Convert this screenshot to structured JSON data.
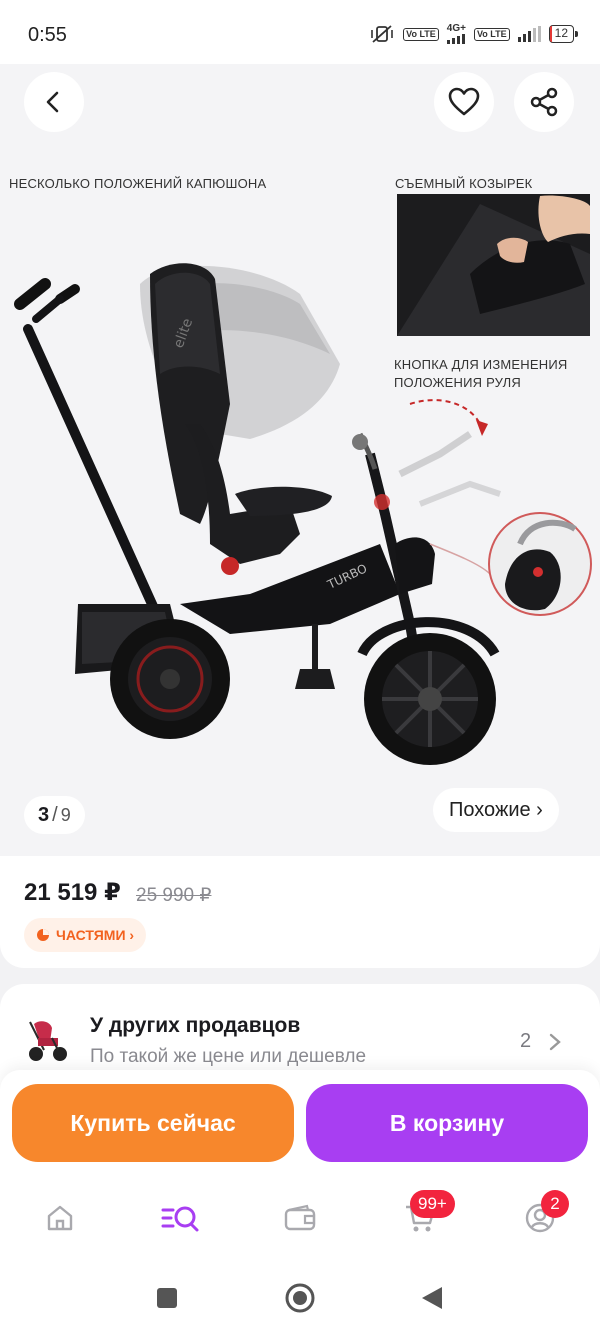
{
  "status_bar": {
    "time": "0:55",
    "volte1": "Vo LTE",
    "network": "4G+",
    "volte2": "Vo LTE",
    "battery": "12"
  },
  "gallery": {
    "captions": {
      "hood": "НЕСКОЛЬКО ПОЛОЖЕНИЙ КАПЮШОНА",
      "visor": "СЪЕМНЫЙ КОЗЫРЕК",
      "handlebar_button": "КНОПКА ДЛЯ ИЗМЕНЕНИЯ ПОЛОЖЕНИЯ РУЛЯ"
    },
    "current_page": "3",
    "separator": "/",
    "total_pages": "9",
    "similar_label": "Похожие ›"
  },
  "price": {
    "current": "21 519 ₽",
    "old": "25 990 ₽",
    "installment_label": "ЧАСТЯМИ ›",
    "installment_color": "#f2621f"
  },
  "other_sellers": {
    "title": "У других продавцов",
    "subtitle": "По такой же цене или дешевле",
    "count": "2"
  },
  "actions": {
    "buy_now": "Купить сейчас",
    "add_to_cart": "В корзину",
    "buy_color": "#f7872c",
    "cart_color": "#a83ef2"
  },
  "bottom_nav": {
    "items": [
      "home-icon",
      "catalog-search-icon",
      "wallet-icon",
      "cart-icon",
      "profile-icon"
    ],
    "cart_badge": "99+",
    "profile_badge": "2",
    "accent": "#a83ef2"
  }
}
